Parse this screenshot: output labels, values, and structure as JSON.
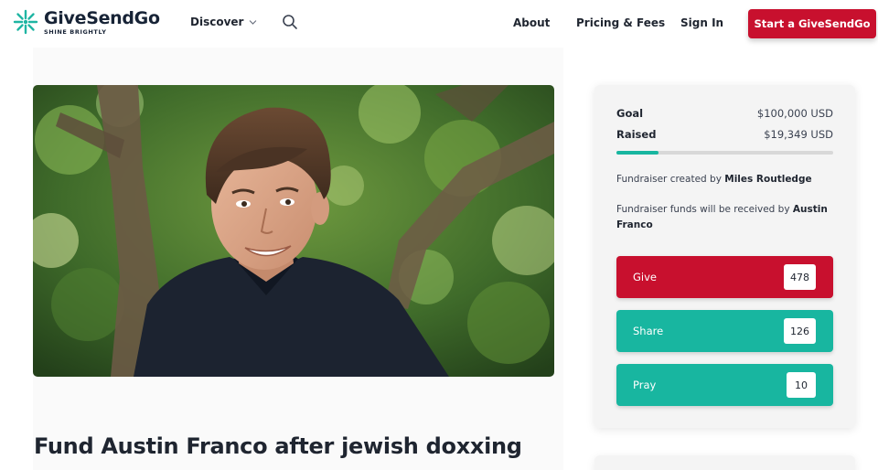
{
  "header": {
    "logo": {
      "name_part1": "Give",
      "name_part2": "SendGo",
      "tagline": "SHINE BRIGHTLY"
    },
    "nav": {
      "discover": "Discover",
      "about": "About",
      "pricing": "Pricing & Fees",
      "signin": "Sign In"
    },
    "cta_label": "Start a GiveSendGo",
    "colors": {
      "brand_red": "#c8102e",
      "brand_teal": "#18b6a0",
      "logo_teal": "#1fb5a3"
    }
  },
  "campaign": {
    "title": "Fund Austin Franco after jewish doxxing",
    "photo_alt": "Photo of smiling young man in dark polo shirt in front of trees"
  },
  "sidebar": {
    "goal_label": "Goal",
    "goal_value": "$100,000 USD",
    "raised_label": "Raised",
    "raised_value": "$19,349 USD",
    "progress_fraction": 0.19349,
    "created_prefix": "Fundraiser created by ",
    "creator": "Miles Routledge",
    "recipient_prefix": "Fundraiser funds will be received by ",
    "recipient": "Austin Franco",
    "actions": [
      {
        "label": "Give",
        "count": "478",
        "color": "#c8102e"
      },
      {
        "label": "Share",
        "count": "126",
        "color": "#18b6a0"
      },
      {
        "label": "Pray",
        "count": "10",
        "color": "#18b6a0"
      }
    ]
  }
}
